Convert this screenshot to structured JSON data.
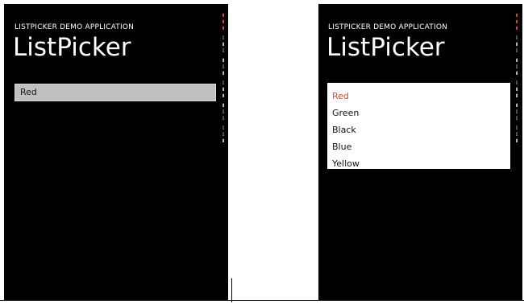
{
  "screens": [
    {
      "app_title": "LISTPICKER DEMO APPLICATION",
      "page_title": "ListPicker",
      "picker": {
        "selected": "Red"
      }
    },
    {
      "app_title": "LISTPICKER DEMO APPLICATION",
      "page_title": "ListPicker",
      "picker": {
        "options": [
          "Red",
          "Green",
          "Black",
          "Blue",
          "Yellow"
        ],
        "selected_index": 0
      }
    }
  ],
  "colors": {
    "phone_background": "#000000",
    "collapsed_picker": "#c0c0c0",
    "expanded_picker": "#ffffff",
    "accent": "#e24a2a"
  }
}
